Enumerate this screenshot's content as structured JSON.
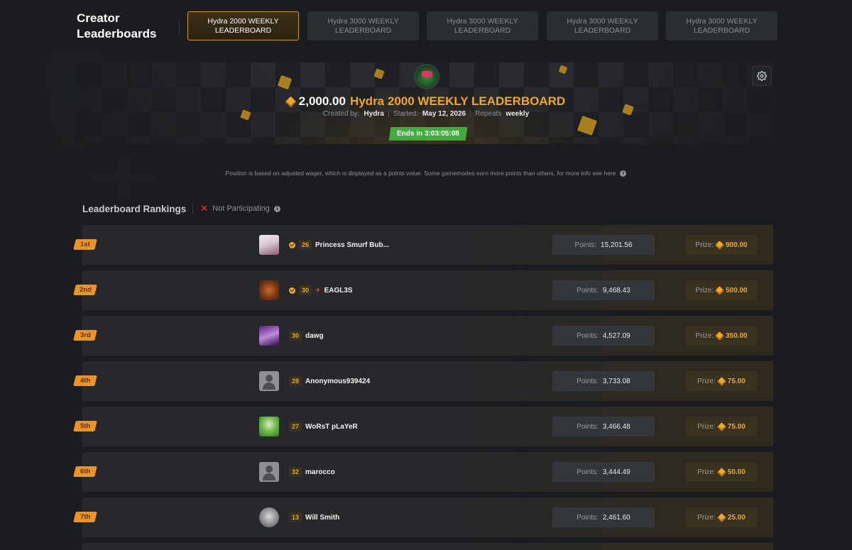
{
  "header": {
    "title": "Creator Leaderboards",
    "tabs": [
      {
        "label": "Hydra 2000 WEEKLY LEADERBOARD",
        "active": true
      },
      {
        "label": "Hydra 3000 WEEKLY LEADERBOARD",
        "active": false
      },
      {
        "label": "Hydra 3000 WEEKLY LEADERBOARD",
        "active": false
      },
      {
        "label": "Hydra 3000 WEEKLY LEADERBOARD",
        "active": false
      },
      {
        "label": "Hydra 3000 WEEKLY LEADERBOARD",
        "active": false
      }
    ]
  },
  "banner": {
    "amount": "2,000.00",
    "name": "Hydra 2000 WEEKLY LEADERBOARD",
    "created_by_label": "Created by:",
    "created_by": "Hydra",
    "started_label": "Started:",
    "started": "May 12, 2026",
    "repeats_label": "Repeats",
    "repeats": "weekly",
    "ends": "Ends in 3:03:05:08",
    "settings_icon": "gear-icon"
  },
  "info_text": "Position is based on adjusted wager, which is displayed as a points value. Some gamemodes earn more points than others, for more info see here",
  "rankings": {
    "title": "Leaderboard Rankings",
    "status": "Not Participating",
    "points_label": "Points:",
    "prize_label": "Prize:",
    "rows": [
      {
        "rank": "1st",
        "level": "26",
        "verified": true,
        "username": "Princess Smurf Bub...",
        "points": "15,201.56",
        "prize": "900.00"
      },
      {
        "rank": "2nd",
        "level": "30",
        "verified": true,
        "username": "EAGL3S",
        "points": "9,468.43",
        "prize": "500.00"
      },
      {
        "rank": "3rd",
        "level": "30",
        "verified": false,
        "username": "dawg",
        "points": "4,527.09",
        "prize": "350.00"
      },
      {
        "rank": "4th",
        "level": "28",
        "verified": false,
        "username": "Anonymous939424",
        "points": "3,733.08",
        "prize": "75.00"
      },
      {
        "rank": "5th",
        "level": "27",
        "verified": false,
        "username": "WoRsT pLaYeR",
        "points": "3,466.48",
        "prize": "75.00"
      },
      {
        "rank": "6th",
        "level": "32",
        "verified": false,
        "username": "marocco",
        "points": "3,444.49",
        "prize": "50.00"
      },
      {
        "rank": "7th",
        "level": "13",
        "verified": false,
        "username": "Will Smith",
        "points": "2,461.60",
        "prize": "25.00"
      }
    ]
  },
  "colors": {
    "accent": "#f0a81e",
    "rank_badge": "#f0921e",
    "ends_badge": "#3fae3c",
    "background": "#1a1c1f"
  }
}
